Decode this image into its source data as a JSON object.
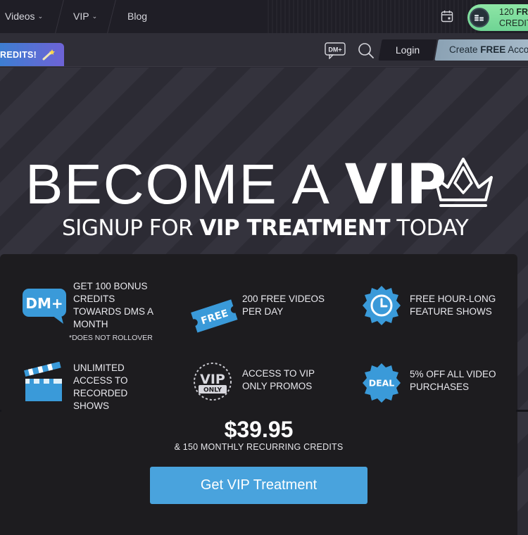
{
  "nav": {
    "items": [
      {
        "label": "Videos",
        "has_dropdown": true
      },
      {
        "label": "VIP",
        "has_dropdown": true
      },
      {
        "label": "Blog",
        "has_dropdown": false
      }
    ],
    "credits_line1_prefix": "120 ",
    "credits_line1_bold": "FRE",
    "credits_line2": "CREDIT",
    "credits_color": "#7fdd9c"
  },
  "subbar": {
    "promo_label": "REDITS!",
    "dm_icon_label": "DM+",
    "login_label": "Login",
    "create_prefix": "Create ",
    "create_bold": "FREE",
    "create_suffix": " Accou"
  },
  "hero": {
    "title_thin": "BECOME A ",
    "title_bold": "VIP",
    "subtitle_pre": "SIGNUP FOR ",
    "subtitle_bold": "VIP TREATMENT",
    "subtitle_post": " TODAY"
  },
  "features": [
    {
      "icon": "dm-plus-icon",
      "icon_text": "DM+",
      "text": "GET 100 BONUS CREDITS TOWARDS DMS A MONTH",
      "note": "*DOES NOT ROLLOVER"
    },
    {
      "icon": "free-ticket-icon",
      "icon_text": "FREE",
      "text": "200 FREE VIDEOS PER DAY",
      "note": ""
    },
    {
      "icon": "clock-badge-icon",
      "icon_text": "",
      "text": "FREE HOUR-LONG FEATURE SHOWS",
      "note": ""
    },
    {
      "icon": "clapperboard-icon",
      "icon_text": "",
      "text": "UNLIMITED ACCESS TO RECORDED SHOWS",
      "note": ""
    },
    {
      "icon": "vip-only-badge-icon",
      "icon_text": "VIP",
      "icon_subtext": "ONLY",
      "text": "ACCESS TO VIP ONLY PROMOS",
      "note": ""
    },
    {
      "icon": "deal-badge-icon",
      "icon_text": "DEAL",
      "text": "5% OFF ALL VIDEO PURCHASES",
      "note": ""
    }
  ],
  "pricing": {
    "price": "$39.95",
    "subtitle": "& 150 MONTHLY RECURRING CREDITS",
    "cta_label": "Get VIP Treatment"
  },
  "colors": {
    "accent_blue": "#49a3dd",
    "icon_blue": "#3a9ad9",
    "card_bg": "#1d1c1f"
  }
}
